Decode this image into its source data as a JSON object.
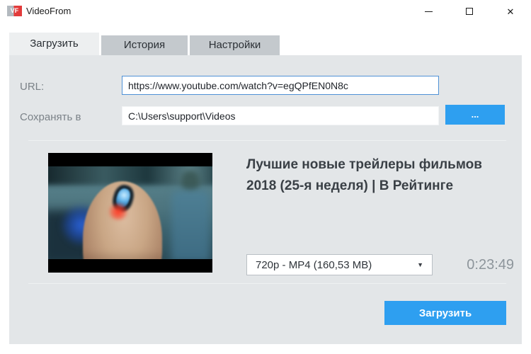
{
  "window": {
    "title": "VideoFrom",
    "icon_text": "VF",
    "close_glyph": "✕"
  },
  "tabs": [
    {
      "label": "Загрузить",
      "active": true
    },
    {
      "label": "История",
      "active": false
    },
    {
      "label": "Настройки",
      "active": false
    }
  ],
  "form": {
    "url_label": "URL:",
    "url_value": "https://www.youtube.com/watch?v=egQPfEN0N8c",
    "save_label": "Сохранять в",
    "save_value": "C:\\Users\\support\\Videos",
    "browse_label": "..."
  },
  "video": {
    "title": "Лучшие новые трейлеры фильмов\n2018 (25-я неделя) | В Рейтинге",
    "format_selected": "720p - MP4 (160,53 MB)",
    "dropdown_arrow": "▼",
    "duration": "0:23:49"
  },
  "actions": {
    "download_label": "Загрузить"
  },
  "colors": {
    "accent": "#2e9ff0",
    "panel_background": "#e3e6e8",
    "inactive_tab": "#c4c9cd",
    "focused_input_border": "#4f91d6"
  }
}
